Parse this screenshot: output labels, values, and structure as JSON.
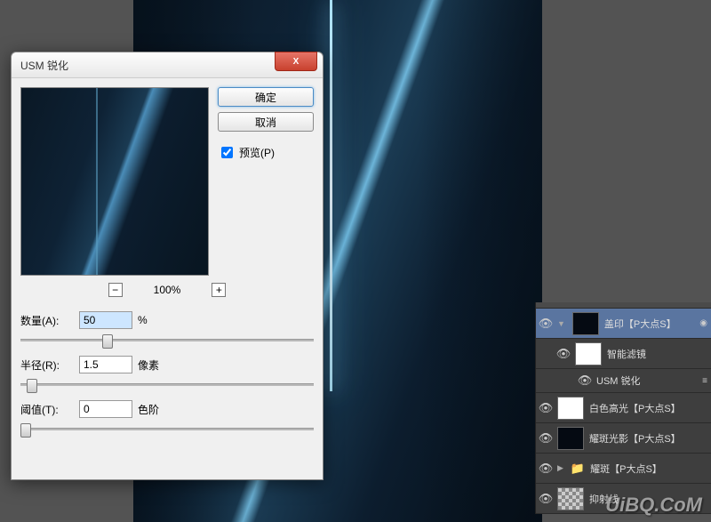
{
  "dialog": {
    "title": "USM 锐化",
    "close": "X",
    "ok": "确定",
    "cancel": "取消",
    "preview_ck": "预览(P)",
    "zoom": "100%",
    "zoom_out": "−",
    "zoom_in": "+",
    "amount_label": "数量(A):",
    "amount_value": "50",
    "amount_unit": "%",
    "radius_label": "半径(R):",
    "radius_value": "1.5",
    "radius_unit": "像素",
    "threshold_label": "阈值(T):",
    "threshold_value": "0",
    "threshold_unit": "色阶"
  },
  "layers": {
    "items": [
      {
        "name": "盖印【P大点S】",
        "thumb": "dark",
        "sel": true,
        "eye": true,
        "arrow": "▼",
        "fx": "◉"
      },
      {
        "name": "智能滤镜",
        "thumb": "white",
        "sub": 1,
        "eye": true
      },
      {
        "name": "USM 锐化",
        "sub": 2,
        "eye": true,
        "fx": "≡"
      },
      {
        "name": "白色高光【P大点S】",
        "thumb": "white",
        "eye": true
      },
      {
        "name": "耀斑光影【P大点S】",
        "thumb": "dark",
        "eye": true
      },
      {
        "name": "耀斑【P大点S】",
        "folder": true,
        "eye": true,
        "arrow": "▶"
      },
      {
        "name": "抑射线",
        "thumb": "trans",
        "eye": true
      }
    ]
  },
  "watermark": "UiBQ.CoM"
}
